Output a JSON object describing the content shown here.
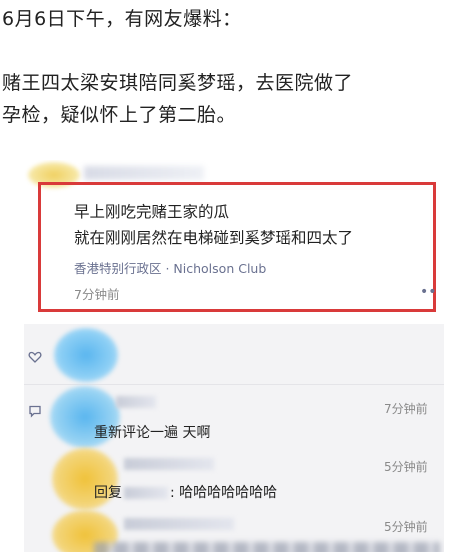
{
  "article": {
    "line1": "6月6日下午，有网友爆料：",
    "line2": "赌王四太梁安琪陪同奚梦瑶，去医院做了",
    "line3": "孕检，疑似怀上了第二胎。"
  },
  "post": {
    "text_line1": "早上刚吃完赌王家的瓜",
    "text_line2": "就在刚刚居然在电梯碰到奚梦瑶和四太了",
    "location": "香港特别行政区 · Nicholson Club",
    "time": "7分钟前",
    "more_icon": "••"
  },
  "comments": [
    {
      "time": "7分钟前",
      "text": "重新评论一遍 天啊"
    },
    {
      "time": "5分钟前",
      "prefix": "回复",
      "text": ": 哈哈哈哈哈哈哈"
    },
    {
      "time": "5分钟前"
    }
  ],
  "colors": {
    "highlight_border": "#d93a3a",
    "link": "#6a7190",
    "comment_bg": "#f3f3f5"
  }
}
